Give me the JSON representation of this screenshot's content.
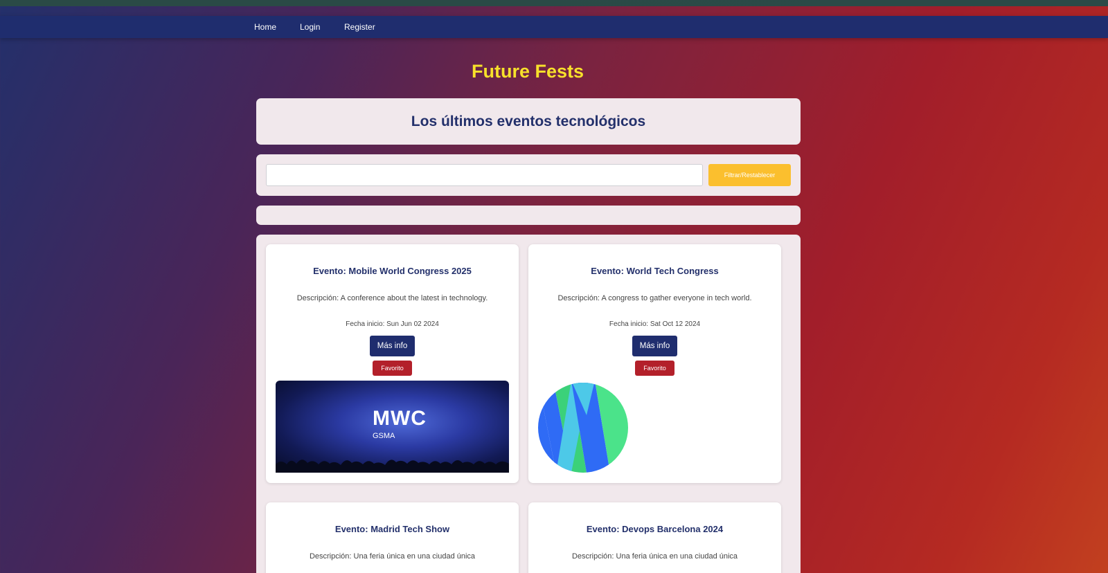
{
  "nav": {
    "home": "Home",
    "login": "Login",
    "register": "Register"
  },
  "site_title": "Future Fests",
  "hero": {
    "heading": "Los últimos eventos tecnológicos"
  },
  "filter": {
    "input_value": "",
    "input_placeholder": "",
    "button_label": "Filtrar/Restablecer"
  },
  "events": [
    {
      "title": "Evento: Mobile World Congress 2025",
      "description": "Descripción: A conference about the latest in technology.",
      "date": "Fecha inicio: Sun Jun 02 2024",
      "info_label": "Más info",
      "fav_label": "Favorito",
      "image_logo": "MWC",
      "image_sub": "GSMA",
      "image_icon": "mwc-stage-photo"
    },
    {
      "title": "Evento: World Tech Congress",
      "description": "Descripción: A congress to gather everyone in tech world.",
      "date": "Fecha inicio: Sat Oct 12 2024",
      "info_label": "Más info",
      "fav_label": "Favorito",
      "image_icon": "w-logo"
    },
    {
      "title": "Evento: Madrid Tech Show",
      "description": "Descripción: Una feria única en una ciudad única"
    },
    {
      "title": "Evento: Devops Barcelona 2024",
      "description": "Descripción: Una feria única en una ciudad única"
    }
  ],
  "colors": {
    "navbar": "#1f2d6e",
    "title": "#f7e12b",
    "panel": "#f1e8ec",
    "filter_button": "#fbbf2e",
    "info_button": "#1f2d6e",
    "fav_button": "#b3202a"
  }
}
